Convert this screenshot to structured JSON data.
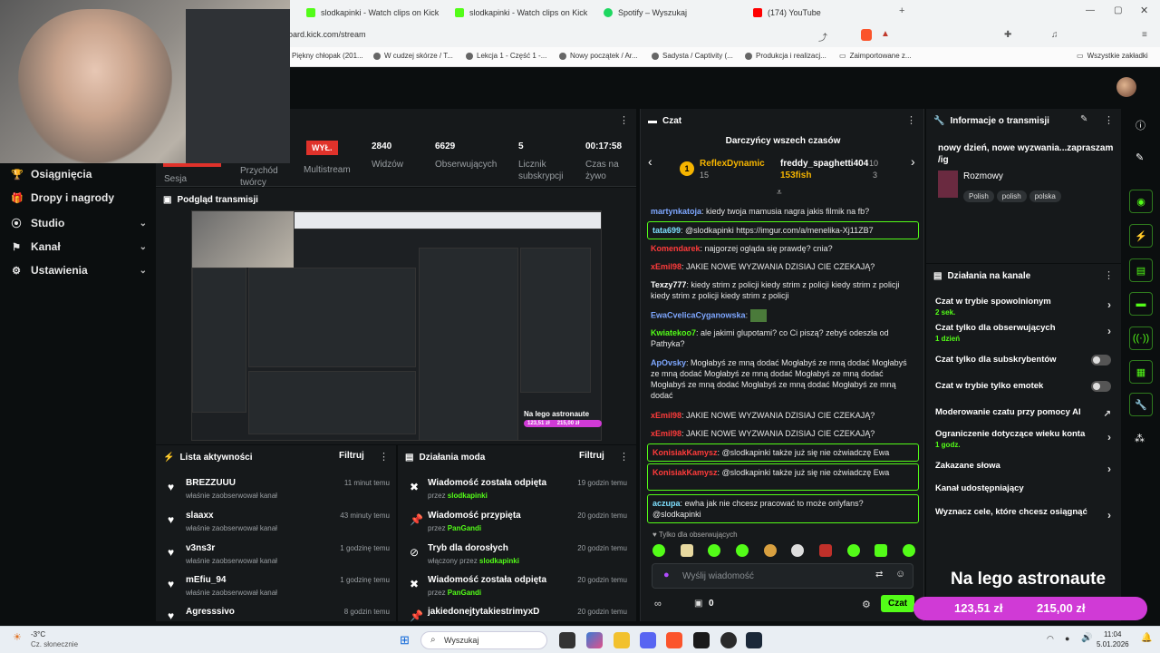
{
  "browser": {
    "tabs": [
      {
        "label": "slodkapinki - Watch clips on Kick",
        "color": "#53fc18"
      },
      {
        "label": "slodkapinki - Watch clips on Kick",
        "color": "#53fc18"
      },
      {
        "label": "Spotify – Wyszukaj",
        "color": "#1ed760"
      },
      {
        "label": "(174) YouTube",
        "color": "#ff0000"
      }
    ],
    "new_tab": "+",
    "url": "oard.kick.com/stream",
    "bookmarks": [
      "Piękny chłopak (201...",
      "W cudzej skórze / T...",
      "Lekcja 1 - Część 1 -...",
      "Nowy początek / Ar...",
      "Sadysta / Captivity (...",
      "Produkcja i realizacj...",
      "Zaimportowane z..."
    ],
    "all_bookmarks": "Wszystkie zakładki"
  },
  "sidebar": {
    "items": [
      {
        "label": "Osiągnięcia",
        "icon": "trophy-icon",
        "glyph": "🏆"
      },
      {
        "label": "Dropy i nagrody",
        "icon": "gift-icon",
        "glyph": "🎁"
      },
      {
        "label": "Studio",
        "icon": "studio-icon",
        "glyph": "⦿",
        "chev": "⌄"
      },
      {
        "label": "Kanał",
        "icon": "channel-icon",
        "glyph": "⚑",
        "chev": "⌄"
      },
      {
        "label": "Ustawienia",
        "icon": "gear-icon",
        "glyph": "⚙",
        "chev": "⌄"
      }
    ]
  },
  "stats": {
    "partial_labels": [
      "Sesja",
      "Przychód twórcy"
    ],
    "offline_badge": "WYŁ.",
    "multistream_label": "Multistream",
    "items": [
      {
        "value": "2840",
        "label": "Widzów"
      },
      {
        "value": "6629",
        "label": "Obserwujących"
      },
      {
        "value": "5",
        "label": "Licznik subskrypcji"
      },
      {
        "value": "00:17:58",
        "label": "Czas na żywo"
      }
    ]
  },
  "preview": {
    "title": "Podgląd transmisji",
    "overlay_text": "Na lego astronaute",
    "overlay_amounts": [
      "123,51 zł",
      "215,00 zł"
    ]
  },
  "activity": {
    "title": "Lista aktywności",
    "filter": "Filtruj",
    "rows": [
      {
        "name": "BREZZUUU",
        "sub": "właśnie zaobserwował kanał",
        "time": "11 minut temu"
      },
      {
        "name": "slaaxx",
        "sub": "właśnie zaobserwował kanał",
        "time": "43 minuty temu"
      },
      {
        "name": "v3ns3r",
        "sub": "właśnie zaobserwował kanał",
        "time": "1 godzinę temu"
      },
      {
        "name": "mEfiu_94",
        "sub": "właśnie zaobserwował kanał",
        "time": "1 godzinę temu"
      },
      {
        "name": "Agresssivo",
        "sub": "",
        "time": "8 godzin temu"
      }
    ]
  },
  "mod": {
    "title": "Działania moda",
    "filter": "Filtruj",
    "rows": [
      {
        "name": "Wiadomość została odpięta",
        "by": "przez",
        "user": "slodkapinki",
        "time": "19 godzin temu",
        "icon": "unpin-icon",
        "glyph": "✖"
      },
      {
        "name": "Wiadomość przypięta",
        "by": "przez",
        "user": "PanGandi",
        "time": "20 godzin temu",
        "icon": "pin-icon",
        "glyph": "📌"
      },
      {
        "name": "Tryb dla dorosłych",
        "by": "włączony przez",
        "user": "slodkapinki",
        "time": "20 godzin temu",
        "icon": "eye-off-icon",
        "glyph": "⊘"
      },
      {
        "name": "Wiadomość została odpięta",
        "by": "przez",
        "user": "PanGandi",
        "time": "20 godzin temu",
        "icon": "unpin-icon",
        "glyph": "✖"
      },
      {
        "name": "jakiedonejtytakiestrimyxD",
        "by": "",
        "user": "",
        "time": "20 godzin temu",
        "icon": "pin-icon",
        "glyph": "📌"
      }
    ]
  },
  "chat": {
    "title": "Czat",
    "top_donors_title": "Darczyńcy wszech czasów",
    "donors": [
      {
        "rank": "1",
        "name": "ReflexDynamic",
        "amount": "15"
      },
      {
        "name": "freddy_spaghetti404",
        "amount": "10"
      },
      {
        "name": "153fish",
        "amount": "3"
      }
    ],
    "messages": [
      {
        "user": "martynkatoja",
        "color": "#7ea7ff",
        "text": "kiedy twoja mamusia nagra jakis filmik na fb?"
      },
      {
        "user": "tata699",
        "color": "#7ee0ff",
        "text": "@slodkapinki https://imgur.com/a/menelika-Xj11ZB7",
        "boxed": true
      },
      {
        "user": "Komendarek",
        "color": "#ff3b3b",
        "text": "najgorzej ogląda się prawdę? cnia?"
      },
      {
        "user": "xEmil98",
        "color": "#ff3b3b",
        "text": "JAKIE NOWE WYZWANIA DZISIAJ CIE CZEKAJĄ?"
      },
      {
        "user": "Texzy777",
        "color": "#ffffff",
        "text": "kiedy strim z policji kiedy strim z policji kiedy strim z policji kiedy strim z policji kiedy strim z policji"
      },
      {
        "user": "EwaCvelicaCyganowska",
        "color": "#7ea7ff",
        "text": ""
      },
      {
        "user": "Kwiatekoo7",
        "color": "#53fc18",
        "text": "ale jakimi glupotami? co Ci piszą? zebyś odeszła od Pathyka?"
      },
      {
        "user": "ApOvsky",
        "color": "#7ea7ff",
        "text": "Mogłabyś ze mną dodać Mogłabyś ze mną dodać Mogłabyś ze mną dodać Mogłabyś ze mną dodać Mogłabyś ze mną dodać Mogłabyś ze mną dodać Mogłabyś ze mną dodać Mogłabyś ze mną dodać"
      },
      {
        "user": "xEmil98",
        "color": "#ff3b3b",
        "text": "JAKIE NOWE WYZWANIA DZISIAJ CIE CZEKAJĄ?"
      },
      {
        "user": "xEmil98",
        "color": "#ff3b3b",
        "text": "JAKIE NOWE WYZWANIA DZISIAJ CIE CZEKAJĄ?"
      },
      {
        "user": "KonisiakKamysz",
        "color": "#ff3b3b",
        "text": "@slodkapinki także już się nie ożwiadczę Ewa",
        "boxed": true
      },
      {
        "user": "KonisiakKamysz",
        "color": "#ff3b3b",
        "text": "@slodkapinki także już się nie ożwiadczę Ewa",
        "boxed": true
      },
      {
        "user": "aczupa",
        "color": "#7ee0ff",
        "text": "ewha jak nie chcesz pracować to może onlyfans? @slodkapinki",
        "boxed": true
      }
    ],
    "followers_only": "Tylko dla obserwujących",
    "input_placeholder": "Wyślij wiadomość",
    "gift_count": "0",
    "send_label": "Czat"
  },
  "info": {
    "title": "Informacje o transmisji",
    "stream_title": "nowy dzień, nowe wyzwania...zapraszam /ig",
    "category": "Rozmowy",
    "tags": [
      "Polish",
      "polish",
      "polska"
    ]
  },
  "channel_actions": {
    "title": "Działania na kanale",
    "items": [
      {
        "label": "Czat w trybie spowolnionym",
        "value": "2 sek.",
        "control": "chevron"
      },
      {
        "label": "Czat tylko dla obserwujących",
        "value": "1 dzień",
        "control": "chevron"
      },
      {
        "label": "Czat tylko dla subskrybentów",
        "value": "",
        "control": "toggle"
      },
      {
        "label": "Czat w trybie tylko emotek",
        "value": "",
        "control": "toggle"
      },
      {
        "label": "Moderowanie czatu przy pomocy AI",
        "value": "",
        "control": "chart"
      },
      {
        "label": "Ograniczenie dotyczące wieku konta",
        "value": "1 godz.",
        "control": "chevron"
      },
      {
        "label": "Zakazane słowa",
        "value": "",
        "control": "chevron"
      },
      {
        "label": "Kanał udostępniający",
        "value": "",
        "control": "none"
      },
      {
        "label": "Wyznacz cele, które chcesz osiągnąć",
        "value": "",
        "control": "chevron"
      }
    ]
  },
  "taskbar": {
    "weather_temp": "-3°C",
    "weather_desc": "Cz. słonecznie",
    "search": "Wyszukaj",
    "time": "11:04",
    "date": "5.01.2026"
  },
  "colors": {
    "accent": "#53fc18",
    "offline": "#e0322b",
    "overlay": "#d03ad6"
  }
}
